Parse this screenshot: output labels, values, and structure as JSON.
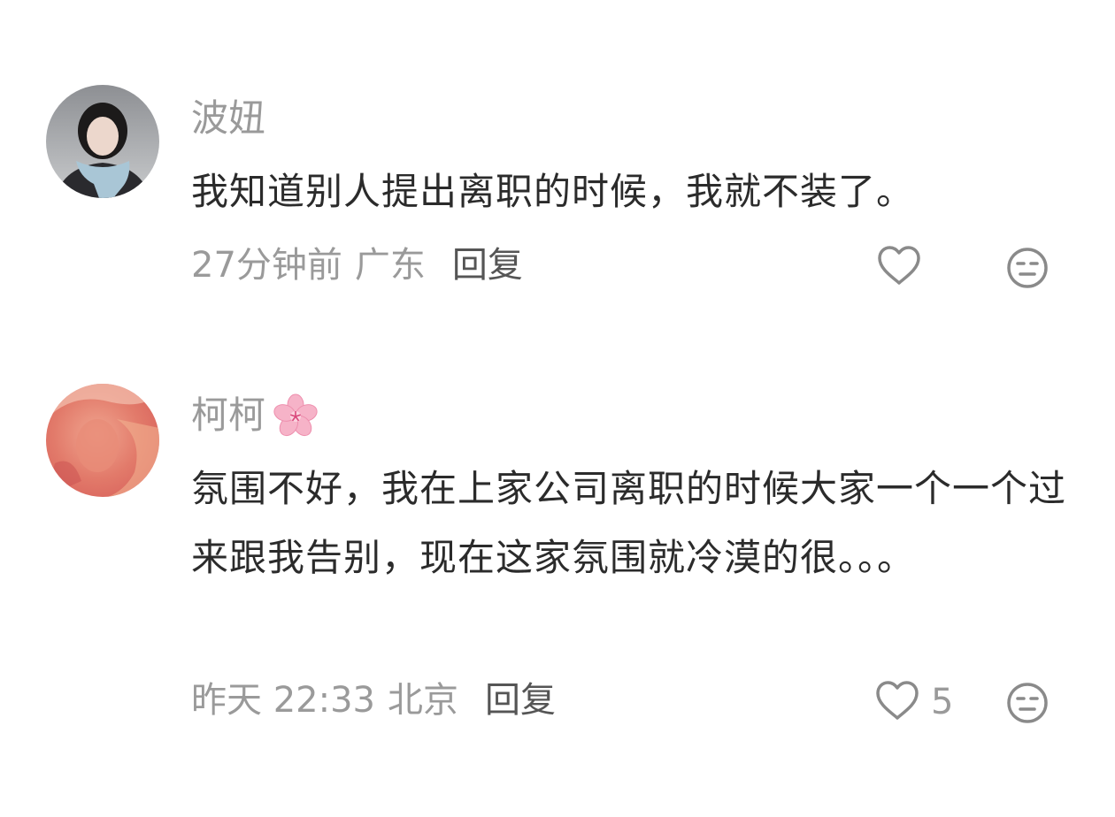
{
  "comments": [
    {
      "username": "波妞",
      "text": "我知道别人提出离职的时候，我就不装了。",
      "time": "27分钟前",
      "location": "广东",
      "reply_label": "回复",
      "like_count": ""
    },
    {
      "username": "柯柯",
      "text": "氛围不好，我在上家公司离职的时候大家一个一个过来跟我告别，现在这家氛围就冷漠的很。。。",
      "time": "昨天 22:33",
      "location": "北京",
      "reply_label": "回复",
      "like_count": "5"
    }
  ],
  "icons": {
    "like": "heart-outline-icon",
    "dislike": "meh-face-icon",
    "username_badge": "cherry-blossom-icon"
  },
  "colors": {
    "username": "#9a9a9a",
    "body": "#2b2b2b",
    "meta": "#9a9a9a",
    "reply": "#555555",
    "icon": "#8a8a8a"
  }
}
